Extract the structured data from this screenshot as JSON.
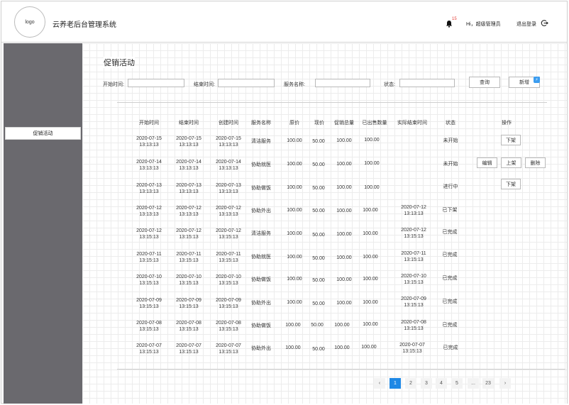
{
  "header": {
    "logo_text": "logo",
    "app_title": "云养老后台管理系统",
    "notification_count": "15",
    "greeting": "Hi，超级管理员",
    "logout_label": "退出登录"
  },
  "sidebar": {
    "items": [
      {
        "label": "促销活动"
      }
    ]
  },
  "page": {
    "title": "促销活动"
  },
  "filters": {
    "start_time_label": "开始时间:",
    "end_time_label": "结束时间:",
    "service_name_label": "服务名称:",
    "status_label": "状态:",
    "start_time_value": "",
    "end_time_value": "",
    "service_name_value": "",
    "status_value": "",
    "search_button": "查询",
    "add_button": "新增"
  },
  "table": {
    "headers": [
      "开始时间",
      "结束时间",
      "创建时间",
      "服务名称",
      "原价",
      "现价",
      "促销总量",
      "已出售数量",
      "实际结束时间",
      "状态",
      "操作"
    ],
    "rows": [
      {
        "start_date": "2020-07-15",
        "start_time": "13:13:13",
        "end_date": "2020-07-15",
        "end_time": "13:13:13",
        "created_date": "2020-07-15",
        "created_time": "13:13:13",
        "service": "清洁服务",
        "original_price": "100.00",
        "current_price": "50.00",
        "promo_total": "100.00",
        "sold": "100.00",
        "actual_end_date": "",
        "actual_end_time": "",
        "status": "未开始",
        "actions": [
          "下架"
        ]
      },
      {
        "start_date": "2020-07-14",
        "start_time": "13:13:13",
        "end_date": "2020-07-14",
        "end_time": "13:13:13",
        "created_date": "2020-07-14",
        "created_time": "13:13:13",
        "service": "协助就医",
        "original_price": "100.00",
        "current_price": "50.00",
        "promo_total": "100.00",
        "sold": "100.00",
        "actual_end_date": "",
        "actual_end_time": "",
        "status": "未开始",
        "actions": [
          "编辑",
          "上架",
          "删除"
        ]
      },
      {
        "start_date": "2020-07-13",
        "start_time": "13:13:13",
        "end_date": "2020-07-13",
        "end_time": "13:13:13",
        "created_date": "2020-07-13",
        "created_time": "13:13:13",
        "service": "协助做饭",
        "original_price": "100.00",
        "current_price": "50.00",
        "promo_total": "100.00",
        "sold": "100.00",
        "actual_end_date": "",
        "actual_end_time": "",
        "status": "进行中",
        "actions": [
          "下架"
        ]
      },
      {
        "start_date": "2020-07-12",
        "start_time": "13:13:13",
        "end_date": "2020-07-12",
        "end_time": "13:13:13",
        "created_date": "2020-07-12",
        "created_time": "13:13:13",
        "service": "协助外出",
        "original_price": "100.00",
        "current_price": "50.00",
        "promo_total": "100.00",
        "sold": "100.00",
        "actual_end_date": "2020-07-12",
        "actual_end_time": "13:13:13",
        "status": "已下架",
        "actions": []
      },
      {
        "start_date": "2020-07-12",
        "start_time": "13:15:13",
        "end_date": "2020-07-12",
        "end_time": "13:15:13",
        "created_date": "2020-07-12",
        "created_time": "13:15:13",
        "service": "清洁服务",
        "original_price": "100.00",
        "current_price": "50.00",
        "promo_total": "100.00",
        "sold": "100.00",
        "actual_end_date": "2020-07-12",
        "actual_end_time": "13:15:13",
        "status": "已完成",
        "actions": []
      },
      {
        "start_date": "2020-07-11",
        "start_time": "13:15:13",
        "end_date": "2020-07-11",
        "end_time": "13:15:13",
        "created_date": "2020-07-11",
        "created_time": "13:15:13",
        "service": "协助就医",
        "original_price": "100.00",
        "current_price": "50.00",
        "promo_total": "100.00",
        "sold": "100.00",
        "actual_end_date": "2020-07-11",
        "actual_end_time": "13:15:13",
        "status": "已完成",
        "actions": []
      },
      {
        "start_date": "2020-07-10",
        "start_time": "13:15:13",
        "end_date": "2020-07-10",
        "end_time": "13:15:13",
        "created_date": "2020-07-10",
        "created_time": "13:15:13",
        "service": "协助做饭",
        "original_price": "100.00",
        "current_price": "50.00",
        "promo_total": "100.00",
        "sold": "100.00",
        "actual_end_date": "2020-07-10",
        "actual_end_time": "13:15:13",
        "status": "已完成",
        "actions": []
      },
      {
        "start_date": "2020-07-09",
        "start_time": "13:15:13",
        "end_date": "2020-07-09",
        "end_time": "13:15:13",
        "created_date": "2020-07-09",
        "created_time": "13:15:13",
        "service": "协助外出",
        "original_price": "100.00",
        "current_price": "50.00",
        "promo_total": "100.00",
        "sold": "100.00",
        "actual_end_date": "2020-07-09",
        "actual_end_time": "13:15:13",
        "status": "已完成",
        "actions": []
      },
      {
        "start_date": "2020-07-08",
        "start_time": "13:15:13",
        "end_date": "2020-07-08",
        "end_time": "13:15:13",
        "created_date": "2020-07-08",
        "created_time": "13:15:13",
        "service": "协助做饭",
        "original_price": "100.00",
        "current_price": "50.00",
        "promo_total": "100.00",
        "sold": "100.00",
        "actual_end_date": "2020-07-08",
        "actual_end_time": "13:15:13",
        "status": "已完成",
        "actions": []
      },
      {
        "start_date": "2020-07-07",
        "start_time": "13:15:13",
        "end_date": "2020-07-07",
        "end_time": "13:15:13",
        "created_date": "2020-07-07",
        "created_time": "13:15:13",
        "service": "协助外出",
        "original_price": "100.00",
        "current_price": "50.00",
        "promo_total": "100.00",
        "sold": "100.00",
        "actual_end_date": "2020-07-07",
        "actual_end_time": "13:15:13",
        "status": "已完成",
        "actions": []
      }
    ]
  },
  "pagination": {
    "prev": "‹",
    "next": "›",
    "pages": [
      "1",
      "2",
      "3",
      "4",
      "5",
      "...",
      "23"
    ],
    "current": "1"
  },
  "colors": {
    "sidebar_bg": "#6a696e",
    "accent": "#1e88e5",
    "badge": "#e5403a"
  }
}
